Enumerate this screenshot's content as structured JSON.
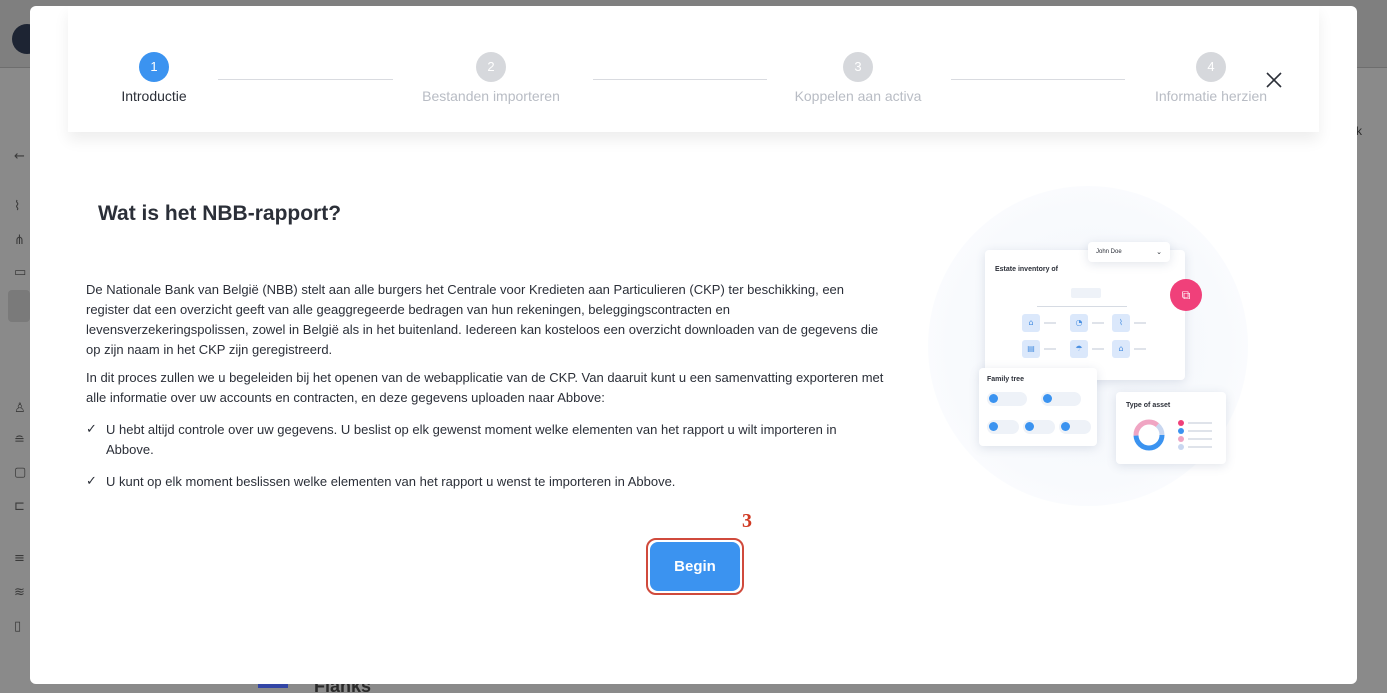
{
  "background": {
    "brand_text": "Flanks",
    "right_edge_char": "k"
  },
  "stepper": {
    "steps": [
      {
        "number": "1",
        "label": "Introductie",
        "state": "active"
      },
      {
        "number": "2",
        "label": "Bestanden importeren",
        "state": "inactive"
      },
      {
        "number": "3",
        "label": "Koppelen aan activa",
        "state": "inactive"
      },
      {
        "number": "4",
        "label": "Informatie herzien",
        "state": "inactive"
      }
    ],
    "close_icon": "close-icon"
  },
  "content": {
    "title": "Wat is het NBB-rapport?",
    "paragraph_1": "De Nationale Bank van België (NBB) stelt aan alle burgers het Centrale voor Kredieten aan Particulieren (CKP) ter beschikking, een register dat een overzicht geeft van alle geaggregeerde bedragen van hun rekeningen, beleggingscontracten en levensverzekeringspolissen, zowel in België als in het buitenland. Iedereen kan kosteloos een overzicht downloaden van de gegevens die op zijn naam in het CKP zijn geregistreerd.",
    "paragraph_2": "In dit proces zullen we u begeleiden bij het openen van de webapplicatie van de CKP. Van daaruit kunt u een samenvatting exporteren met alle informatie over uw accounts en contracten, en deze gegevens uploaden naar Abbove:",
    "check_1": "U hebt altijd controle over uw gegevens. U beslist op elk gewenst moment welke elementen van het rapport u wilt importeren in Abbove.",
    "check_2": "U kunt op elk moment beslissen welke elementen van het rapport u wenst te importeren in Abbove.",
    "check_symbol": "✓"
  },
  "begin_button": {
    "label": "Begin"
  },
  "annotation": {
    "label": "3"
  },
  "illustration": {
    "estate_title": "Estate inventory of",
    "user_select": "John Doe",
    "family_title": "Family tree",
    "asset_title": "Type of asset"
  },
  "colors": {
    "accent": "#3b93f0",
    "highlight": "#d04a3c",
    "pink": "#f0407a"
  }
}
